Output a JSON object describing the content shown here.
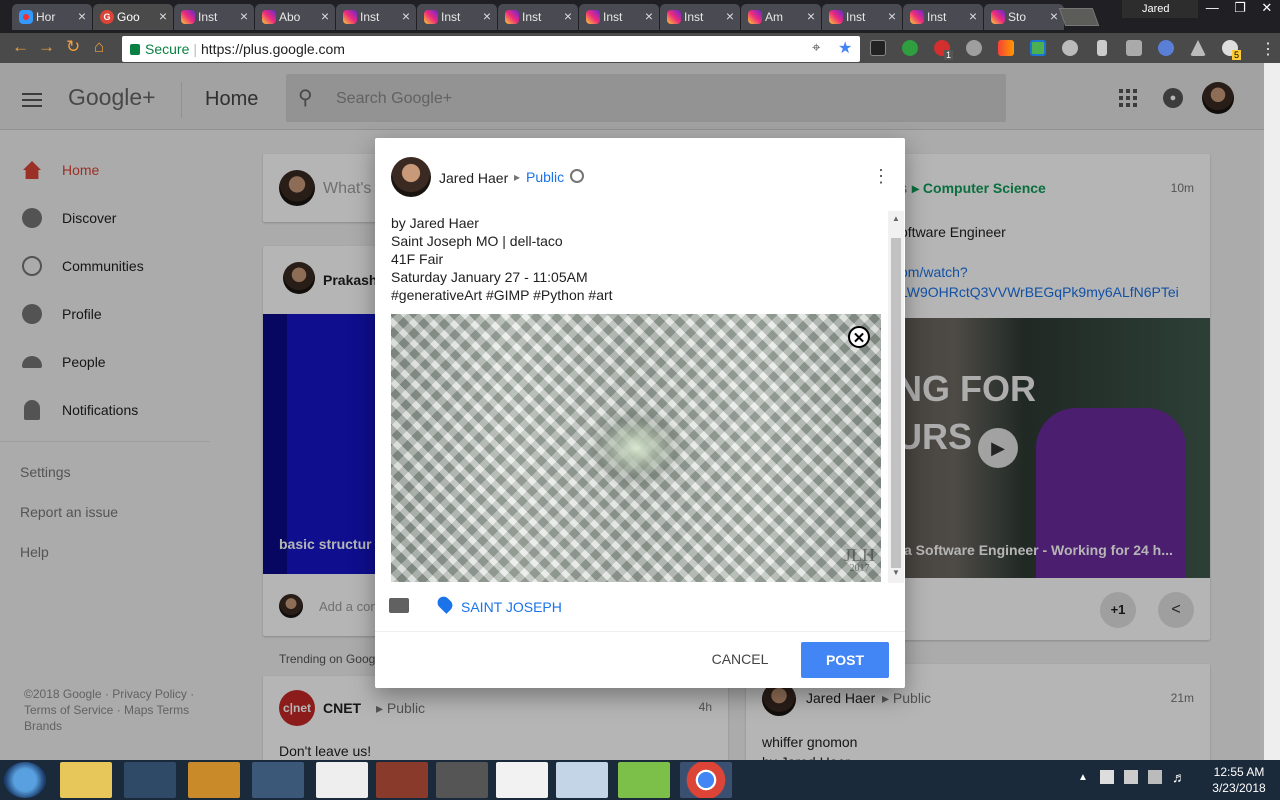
{
  "browser": {
    "tabs": [
      {
        "label": "Hor",
        "fav": "h"
      },
      {
        "label": "Goo",
        "fav": "g",
        "active": true
      },
      {
        "label": "Inst",
        "fav": "i"
      },
      {
        "label": "Abo",
        "fav": "i"
      },
      {
        "label": "Inst",
        "fav": "i"
      },
      {
        "label": "Inst",
        "fav": "i"
      },
      {
        "label": "Inst",
        "fav": "i"
      },
      {
        "label": "Inst",
        "fav": "i"
      },
      {
        "label": "Inst",
        "fav": "i"
      },
      {
        "label": "Am",
        "fav": "i"
      },
      {
        "label": "Inst",
        "fav": "i"
      },
      {
        "label": "Inst",
        "fav": "i"
      },
      {
        "label": "Sto",
        "fav": "i"
      }
    ],
    "profile_name": "Jared",
    "secure_label": "Secure",
    "url": "https://plus.google.com",
    "extension_badge_1": "1",
    "extension_badge_2": "5"
  },
  "app": {
    "logo": "Google+",
    "page_title": "Home",
    "search_placeholder": "Search Google+"
  },
  "nav": {
    "items": [
      {
        "label": "Home",
        "icon": "home-icon",
        "selected": true
      },
      {
        "label": "Discover",
        "icon": "compass-icon"
      },
      {
        "label": "Communities",
        "icon": "communities-icon"
      },
      {
        "label": "Profile",
        "icon": "profile-icon"
      },
      {
        "label": "People",
        "icon": "people-icon"
      },
      {
        "label": "Notifications",
        "icon": "bell-icon"
      }
    ],
    "settings": "Settings",
    "report": "Report an issue",
    "help": "Help",
    "footer": {
      "copyright": "©2018 Google",
      "privacy": "Privacy Policy",
      "terms": "Terms of Service",
      "maps_terms": "Maps Terms",
      "brands": "Brands"
    }
  },
  "feed": {
    "compose_placeholder": "What's",
    "post1": {
      "author": "Prakash",
      "caption": "basic structur",
      "comment_placeholder": "Add a com"
    },
    "trending_label": "Trending on Googl",
    "post2": {
      "author": "CNET",
      "visibility": "Public",
      "time": "4h",
      "text": "Don't leave us!"
    },
    "post3": {
      "community_suffix": "s",
      "community": "Computer Science",
      "time": "10m",
      "line1": "oftware Engineer",
      "link1": "om/watch?",
      "link2": "LW9OHRctQ3VVWrBEGqPk9my6ALfN6PTei",
      "video_title_1": "NG FOR",
      "video_title_2": "URS",
      "video_caption": "a Software Engineer - Working for 24 h...",
      "plus_one": "+1"
    },
    "post4": {
      "author": "Jared Haer",
      "visibility": "Public",
      "time": "21m",
      "text": "whiffer gnomon",
      "text2": "by Jared Haer"
    }
  },
  "dialog": {
    "author": "Jared Haer",
    "visibility": "Public",
    "body_lines": [
      "by Jared Haer",
      "Saint Joseph MO | dell-taco",
      "41F Fair",
      "Saturday January 27 - 11:05AM",
      "#generativeArt #GIMP #Python #art"
    ],
    "watermark": "JLH",
    "watermark_year": "2017",
    "location": "SAINT JOSEPH",
    "cancel": "CANCEL",
    "post": "POST"
  },
  "taskbar": {
    "time": "12:55 AM",
    "date": "3/23/2018"
  }
}
